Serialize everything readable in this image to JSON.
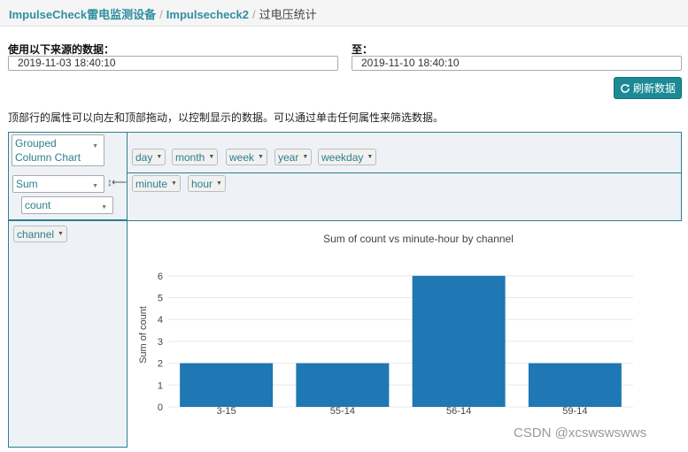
{
  "breadcrumb": {
    "item1": "ImpulseCheck雷电监测设备",
    "item2": "Impulsecheck2",
    "current": "过电压统计",
    "separator": "/"
  },
  "date_range": {
    "from_label": "使用以下来源的数据：",
    "from_value": "2019-11-03 18:40:10",
    "to_label": "至：",
    "to_value": "2019-11-10 18:40:10"
  },
  "refresh_button": {
    "label": "刷新数据",
    "icon": "refresh-icon"
  },
  "instruction": "顶部行的属性可以向左和顶部拖动，以控制显示的数据。可以通过单击任何属性来筛选数据。",
  "pivot": {
    "renderer": {
      "line1": "Grouped",
      "line2": "Column Chart"
    },
    "unused_attrs": [
      "day",
      "month",
      "week",
      "year",
      "weekday"
    ],
    "aggregator": "Sum",
    "agg_field": "count",
    "swap_icon": "↕⟵",
    "col_attrs": [
      "minute",
      "hour"
    ],
    "row_attrs": [
      "channel"
    ]
  },
  "chart_data": {
    "type": "bar",
    "title": "Sum of count vs minute-hour by channel",
    "ylabel": "Sum of count",
    "xlabel": "",
    "categories": [
      "3-15",
      "55-14",
      "56-14",
      "59-14"
    ],
    "values": [
      2,
      2,
      6,
      2
    ],
    "ylim": [
      0,
      6.6
    ],
    "yticks": [
      0,
      1,
      2,
      3,
      4,
      5,
      6
    ],
    "grid": true,
    "bar_color": "#1f77b4"
  },
  "watermark": "CSDN @xcswswswws",
  "colors": {
    "accent": "#2c7f8c",
    "button": "#1b8a95",
    "panel": "#eef2f7"
  }
}
